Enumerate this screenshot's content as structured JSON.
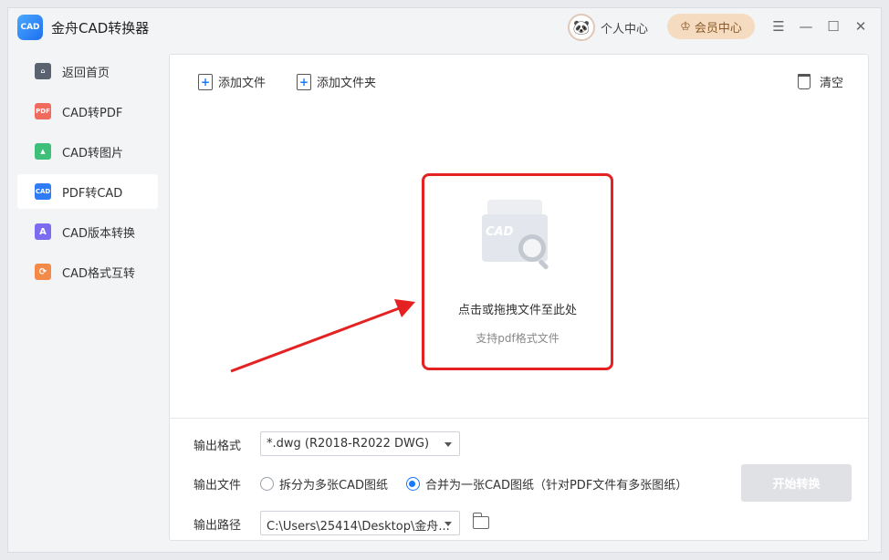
{
  "app": {
    "logo_text": "CAD",
    "title": "金舟CAD转换器"
  },
  "header": {
    "user_center_label": "个人中心",
    "vip_label": "会员中心",
    "icons": [
      "menu-icon",
      "minimize-icon",
      "maximize-icon",
      "close-icon"
    ]
  },
  "sidebar": {
    "items": [
      {
        "label": "返回首页",
        "icon": "home-icon",
        "icon_text": "",
        "color": "#5a6270",
        "active": false
      },
      {
        "label": "CAD转PDF",
        "icon": "pdf-icon",
        "icon_text": "PDF",
        "color": "#f06a5e",
        "active": false
      },
      {
        "label": "CAD转图片",
        "icon": "image-icon",
        "icon_text": "",
        "color": "#3fc07a",
        "active": false
      },
      {
        "label": "PDF转CAD",
        "icon": "cad-icon",
        "icon_text": "CAD",
        "color": "#2f7cf6",
        "active": true
      },
      {
        "label": "CAD版本转换",
        "icon": "version-icon",
        "icon_text": "A",
        "color": "#7b6cf2",
        "active": false
      },
      {
        "label": "CAD格式互转",
        "icon": "format-swap-icon",
        "icon_text": "",
        "color": "#f28a4a",
        "active": false
      }
    ]
  },
  "toolbar": {
    "add_file": "添加文件",
    "add_folder": "添加文件夹",
    "clear": "清空"
  },
  "dropzone": {
    "illus_text": "CAD",
    "main_text": "点击或拖拽文件至此处",
    "sub_text": "支持pdf格式文件",
    "border_color": "#e52222"
  },
  "settings": {
    "format_label": "输出格式",
    "format_value": "*.dwg (R2018-R2022 DWG)",
    "file_label": "输出文件",
    "option_split": "拆分为多张CAD图纸",
    "option_merge": "合并为一张CAD图纸（针对PDF文件有多张图纸）",
    "selected_option": "merge",
    "path_label": "输出路径",
    "path_value": "C:\\Users\\25414\\Desktop\\金舟..."
  },
  "start_button": "开始转换",
  "colors": {
    "accent": "#1677ff",
    "vip_bg": "#f5dcc0",
    "arrow": "#e52222"
  }
}
